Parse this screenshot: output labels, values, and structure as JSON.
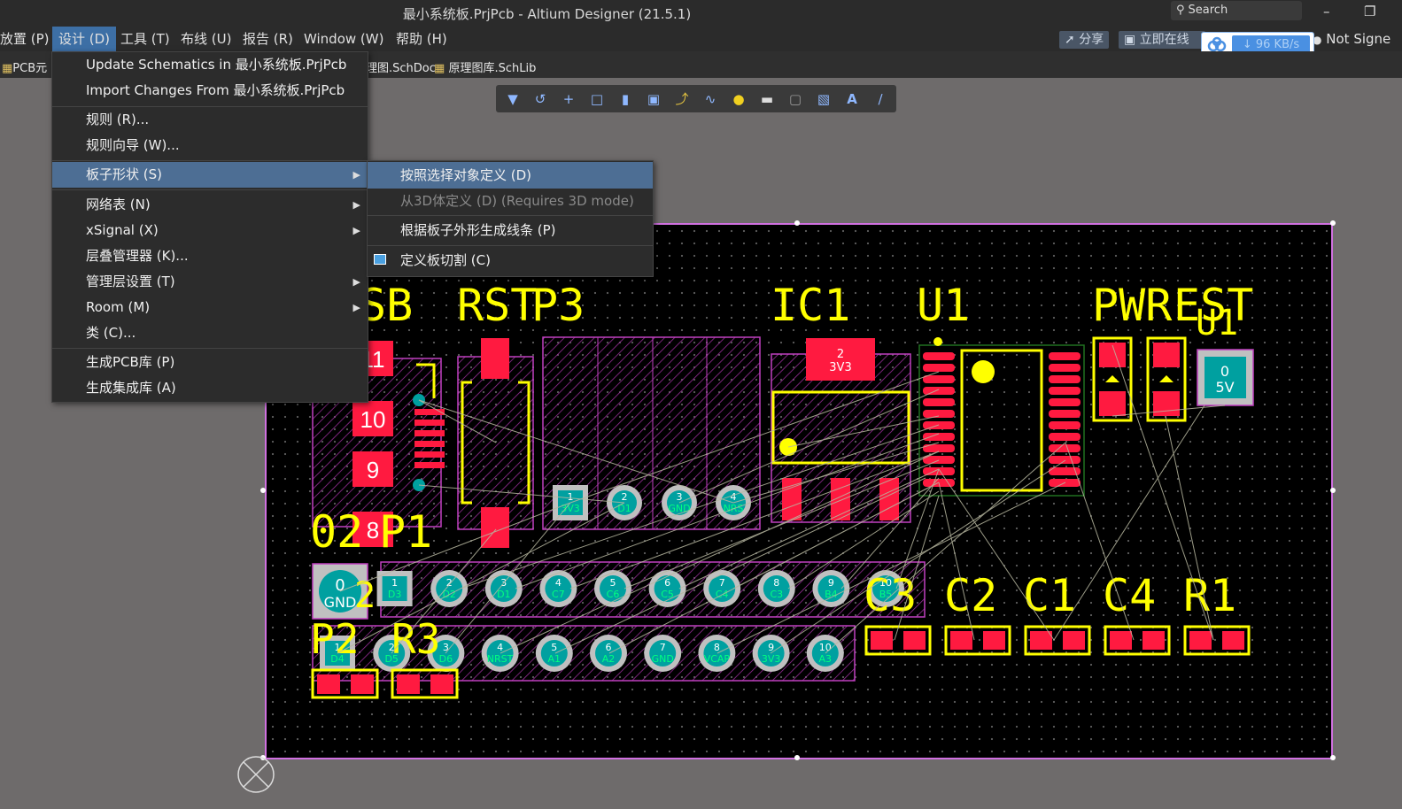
{
  "window": {
    "title": "最小系统板.PrjPcb - Altium Designer (21.5.1)",
    "search_placeholder": "Search",
    "minimize_glyph": "–",
    "restore_glyph": "❐"
  },
  "menubar": {
    "items": [
      "放置 (P)",
      "设计 (D)",
      "工具 (T)",
      "布线 (U)",
      "报告 (R)",
      "Window (W)",
      "帮助 (H)"
    ],
    "active_index": 1,
    "share_label": "分享",
    "online_label": "立即在线账",
    "account_label": "Not Signe"
  },
  "download_speed": "96 KB/s",
  "tabs": {
    "items": [
      "PCB元",
      "理图.SchDoc",
      "原理图库.SchLib"
    ]
  },
  "toolbar": {
    "icons": [
      "filter-icon",
      "route-icon",
      "cross-icon",
      "select-rect-icon",
      "bar-chart-icon",
      "component-icon",
      "interactive-route-icon",
      "diff-pair-icon",
      "via-icon",
      "fill-icon",
      "region-icon",
      "string-icon",
      "text-icon",
      "line-icon"
    ]
  },
  "design_menu": {
    "items": [
      {
        "label": "Update Schematics in 最小系统板.PrjPcb",
        "submenu": false
      },
      {
        "label": "Import Changes From 最小系统板.PrjPcb",
        "submenu": false
      },
      {
        "label": "规则 (R)...",
        "submenu": false
      },
      {
        "label": "规则向导 (W)...",
        "submenu": false
      },
      {
        "label": "板子形状 (S)",
        "submenu": true
      },
      {
        "label": "网络表 (N)",
        "submenu": true
      },
      {
        "label": "xSignal (X)",
        "submenu": true
      },
      {
        "label": "层叠管理器 (K)...",
        "submenu": false
      },
      {
        "label": "管理层设置 (T)",
        "submenu": true
      },
      {
        "label": "Room (M)",
        "submenu": true
      },
      {
        "label": "类 (C)...",
        "submenu": false
      },
      {
        "label": "生成PCB库 (P)",
        "submenu": false
      },
      {
        "label": "生成集成库 (A)",
        "submenu": false
      }
    ],
    "highlighted_index": 4
  },
  "board_shape_submenu": {
    "items": [
      {
        "label": "按照选择对象定义 (D)",
        "enabled": true
      },
      {
        "label": "从3D体定义 (D) (Requires 3D mode)",
        "enabled": false
      },
      {
        "label": "根据板子外形生成线条 (P)",
        "enabled": true
      },
      {
        "label": "定义板切割 (C)",
        "enabled": true
      }
    ],
    "highlighted_index": 0
  },
  "pcb": {
    "designators": [
      "SB",
      "RST",
      "P3",
      "IC1",
      "U1",
      "PWR",
      "EST",
      "U1",
      "02",
      "P1",
      "2",
      "P2",
      "R3",
      "C3",
      "C2",
      "C1",
      "C4",
      "R1"
    ],
    "pads_top_header": [
      {
        "num": "1",
        "net": "3V3"
      },
      {
        "num": "2",
        "net": "D1"
      },
      {
        "num": "3",
        "net": "GND"
      },
      {
        "num": "4",
        "net": "NRS"
      }
    ],
    "pads_row1": [
      {
        "num": "0",
        "net": "GND"
      },
      {
        "num": "1",
        "net": "D3"
      },
      {
        "num": "2",
        "net": "D2"
      },
      {
        "num": "3",
        "net": "D1"
      },
      {
        "num": "4",
        "net": "C7"
      },
      {
        "num": "5",
        "net": "C6"
      },
      {
        "num": "6",
        "net": "C5"
      },
      {
        "num": "7",
        "net": "C4"
      },
      {
        "num": "8",
        "net": "C3"
      },
      {
        "num": "9",
        "net": "B4"
      },
      {
        "num": "10",
        "net": "B5"
      }
    ],
    "pads_row2": [
      {
        "num": "1",
        "net": "D4"
      },
      {
        "num": "2",
        "net": "D5"
      },
      {
        "num": "3",
        "net": "D6"
      },
      {
        "num": "4",
        "net": "NRST"
      },
      {
        "num": "5",
        "net": "A1"
      },
      {
        "num": "6",
        "net": "A2"
      },
      {
        "num": "7",
        "net": "GND"
      },
      {
        "num": "8",
        "net": "VCAP"
      },
      {
        "num": "9",
        "net": "3V3"
      },
      {
        "num": "10",
        "net": "A3"
      }
    ],
    "usb_pad_numbers": [
      "11",
      "10",
      "9",
      "8"
    ],
    "ic1_pad": {
      "num": "2",
      "net": "3V3"
    },
    "pwr_pad": {
      "num": "0",
      "net": "5V"
    }
  },
  "colors": {
    "silkscreen": "#ffff00",
    "pad_smd": "#ff1a40",
    "courtyard": "#c040c0",
    "pad_thru": "#00a0a0",
    "board_outline": "#d070e0",
    "menu_highlight": "#4d6e94",
    "ratsnest": "#b8b8a0"
  }
}
